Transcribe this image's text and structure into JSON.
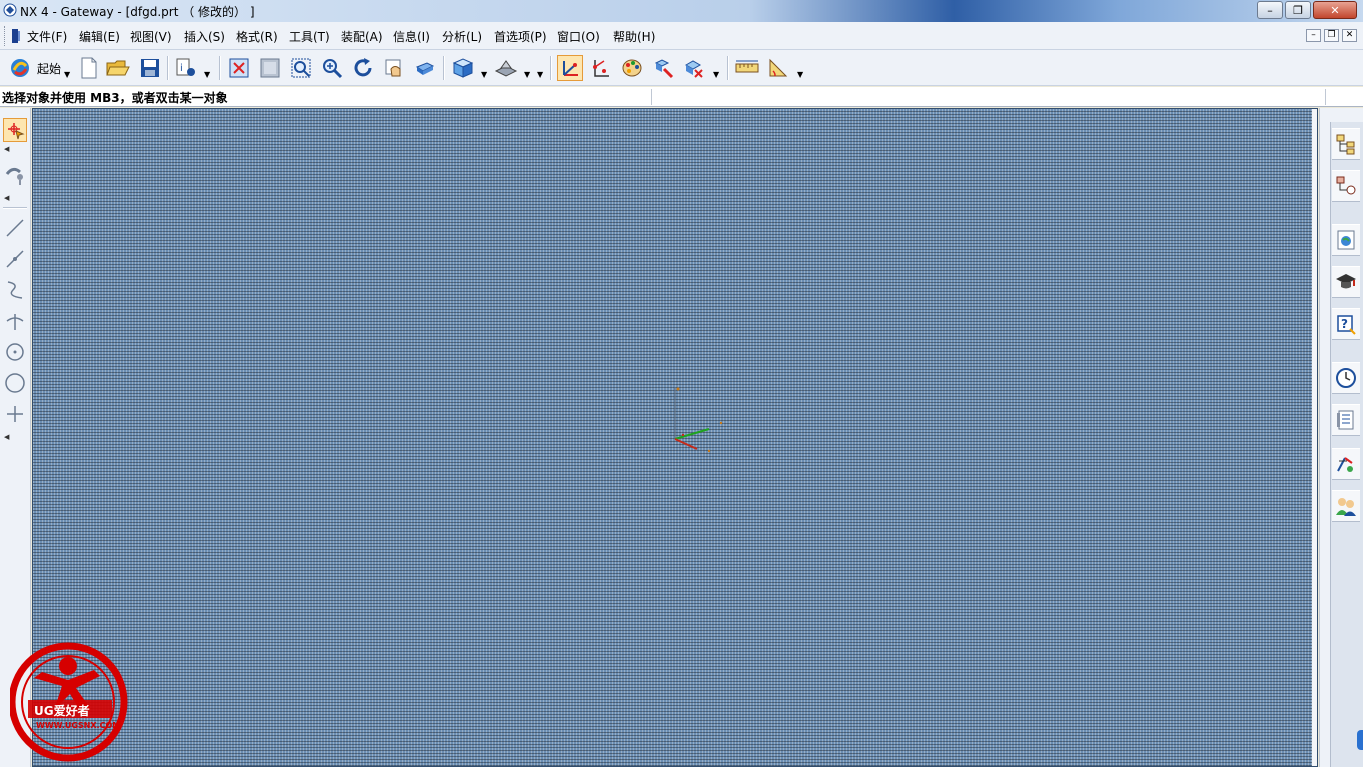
{
  "window": {
    "title": "NX 4 - Gateway - [dfgd.prt （ 修改的） ]",
    "controls": [
      "minimize",
      "restore",
      "close"
    ]
  },
  "menubar": {
    "items": [
      {
        "label": "文件(F)"
      },
      {
        "label": "编辑(E)"
      },
      {
        "label": "视图(V)"
      },
      {
        "label": "插入(S)"
      },
      {
        "label": "格式(R)"
      },
      {
        "label": "工具(T)"
      },
      {
        "label": "装配(A)"
      },
      {
        "label": "信息(I)"
      },
      {
        "label": "分析(L)"
      },
      {
        "label": "首选项(P)"
      },
      {
        "label": "窗口(O)"
      },
      {
        "label": "帮助(H)"
      }
    ]
  },
  "toolbar": {
    "start_label": "起始",
    "icons": [
      "start-icon",
      "new-file-icon",
      "open-folder-icon",
      "save-icon",
      "properties-icon",
      "fit-view-icon",
      "zoom-window-icon",
      "zoom-fit-icon",
      "zoom-icon",
      "rotate-icon",
      "pan-icon",
      "shaded-view-icon",
      "cube-view-icon",
      "render-style-icon",
      "wcs-icon",
      "point-snap-icon",
      "color-palette-icon",
      "edit-object-icon",
      "display-hide-icon",
      "measure-distance-icon",
      "measure-angle-icon"
    ]
  },
  "cue_line": {
    "text": "选择对象并使用 MB3，或者双击某一对象"
  },
  "left_toolbar": {
    "icons": [
      "select-icon",
      "snap-icon",
      "line-icon",
      "line-through-icon",
      "spline-icon",
      "intersection-icon",
      "arc-icon",
      "circle-icon",
      "point-icon"
    ]
  },
  "resource_bar": {
    "icons": [
      "assembly-navigator-icon",
      "part-navigator-icon",
      "web-browser-icon",
      "training-icon",
      "help-icon",
      "history-icon",
      "reuse-library-icon",
      "process-icon",
      "roles-icon"
    ]
  },
  "watermark": {
    "brand": "UG爱好者",
    "url": "WWW.UGSNX.COM"
  },
  "colors": {
    "graphics_bg": "#6b8eb3",
    "toolbar_bg": "#eef2f8",
    "active_highlight": "#fde6b0",
    "watermark_red": "#d60000"
  }
}
